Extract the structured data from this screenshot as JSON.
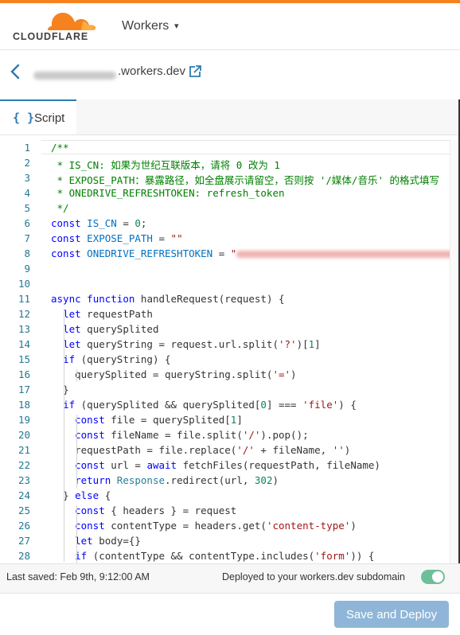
{
  "header": {
    "logo_text": "CLOUDFLARE",
    "product_label": "Workers",
    "product_caret": "▾"
  },
  "subheader": {
    "back_icon": "chevron-left-icon",
    "domain_suffix": ".workers.dev",
    "external_icon": "external-link-icon"
  },
  "tabs": [
    {
      "icon_text": "{ }",
      "label": "Script"
    }
  ],
  "editor": {
    "line_numbers": [
      "1",
      "2",
      "3",
      "4",
      "5",
      "6",
      "7",
      "8",
      "9",
      "10",
      "11",
      "12",
      "13",
      "14",
      "15",
      "16",
      "17",
      "18",
      "19",
      "20",
      "21",
      "22",
      "23",
      "24",
      "25",
      "26",
      "27",
      "28"
    ],
    "lines": [
      "/**",
      " * IS_CN: 如果为世纪互联版本，请将 0 改为 1",
      " * EXPOSE_PATH：暴露路径，如全盘展示请留空，否则按 '/媒体/音乐' 的格式填写",
      " * ONEDRIVE_REFRESHTOKEN: refresh_token",
      " */",
      "const IS_CN = 0;",
      "const EXPOSE_PATH = \"\"",
      "const ONEDRIVE_REFRESHTOKEN = \"",
      "",
      "",
      "async function handleRequest(request) {",
      "  let requestPath",
      "  let querySplited",
      "  let queryString = request.url.split('?')[1]",
      "  if (queryString) {",
      "    querySplited = queryString.split('=')",
      "  }",
      "  if (querySplited && querySplited[0] === 'file') {",
      "    const file = querySplited[1]",
      "    const fileName = file.split('/').pop();",
      "    requestPath = file.replace('/' + fileName, '')",
      "    const url = await fetchFiles(requestPath, fileName)",
      "    return Response.redirect(url, 302)",
      "  } else {",
      "    const { headers } = request",
      "    const contentType = headers.get('content-type')",
      "    let body={}",
      "    if (contentType && contentType.includes('form')) {"
    ]
  },
  "status": {
    "last_saved": "Last saved: Feb 9th, 9:12:00 AM",
    "deployed_label": "Deployed to your workers.dev subdomain",
    "toggle_on": true
  },
  "footer": {
    "deploy_button": "Save and Deploy"
  },
  "colors": {
    "brand_orange": "#f6821f",
    "link_blue": "#2c7cb0",
    "button_disabled_blue": "#8fb6d9",
    "toggle_green": "#6dbf9a"
  }
}
